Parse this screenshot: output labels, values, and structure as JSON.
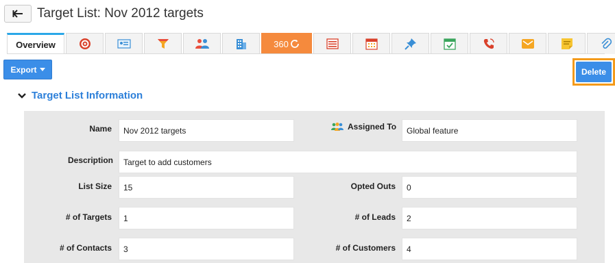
{
  "header": {
    "title": "Target List: Nov 2012 targets"
  },
  "tabs": [
    {
      "label": "Overview",
      "icon": "overview"
    },
    {
      "label": "",
      "icon": "target-icon"
    },
    {
      "label": "",
      "icon": "contact-card-icon"
    },
    {
      "label": "",
      "icon": "funnel-icon"
    },
    {
      "label": "",
      "icon": "people-icon"
    },
    {
      "label": "",
      "icon": "building-icon"
    },
    {
      "label": "360",
      "icon": "refresh-icon"
    },
    {
      "label": "",
      "icon": "list-icon"
    },
    {
      "label": "",
      "icon": "calendar-icon"
    },
    {
      "label": "",
      "icon": "pin-icon"
    },
    {
      "label": "",
      "icon": "check-calendar-icon"
    },
    {
      "label": "",
      "icon": "phone-icon"
    },
    {
      "label": "",
      "icon": "mail-icon"
    },
    {
      "label": "",
      "icon": "note-icon"
    },
    {
      "label": "",
      "icon": "paperclip-icon"
    }
  ],
  "toolbar": {
    "export_label": "Export",
    "delete_label": "Delete"
  },
  "section": {
    "title": "Target List Information"
  },
  "fields": {
    "name_label": "Name",
    "name_value": "Nov 2012 targets",
    "assigned_label": "Assigned To",
    "assigned_value": "Global feature",
    "description_label": "Description",
    "description_value": "Target to add customers",
    "list_size_label": "List Size",
    "list_size_value": "15",
    "opted_outs_label": "Opted Outs",
    "opted_outs_value": "0",
    "targets_label": "# of Targets",
    "targets_value": "1",
    "leads_label": "# of Leads",
    "leads_value": "2",
    "contacts_label": "# of Contacts",
    "contacts_value": "3",
    "customers_label": "# of Customers",
    "customers_value": "4"
  },
  "colors": {
    "accent": "#3b8ee8",
    "tab_360": "#f58a3d",
    "highlight": "#f49a1a",
    "section_title": "#2c7fd9"
  }
}
